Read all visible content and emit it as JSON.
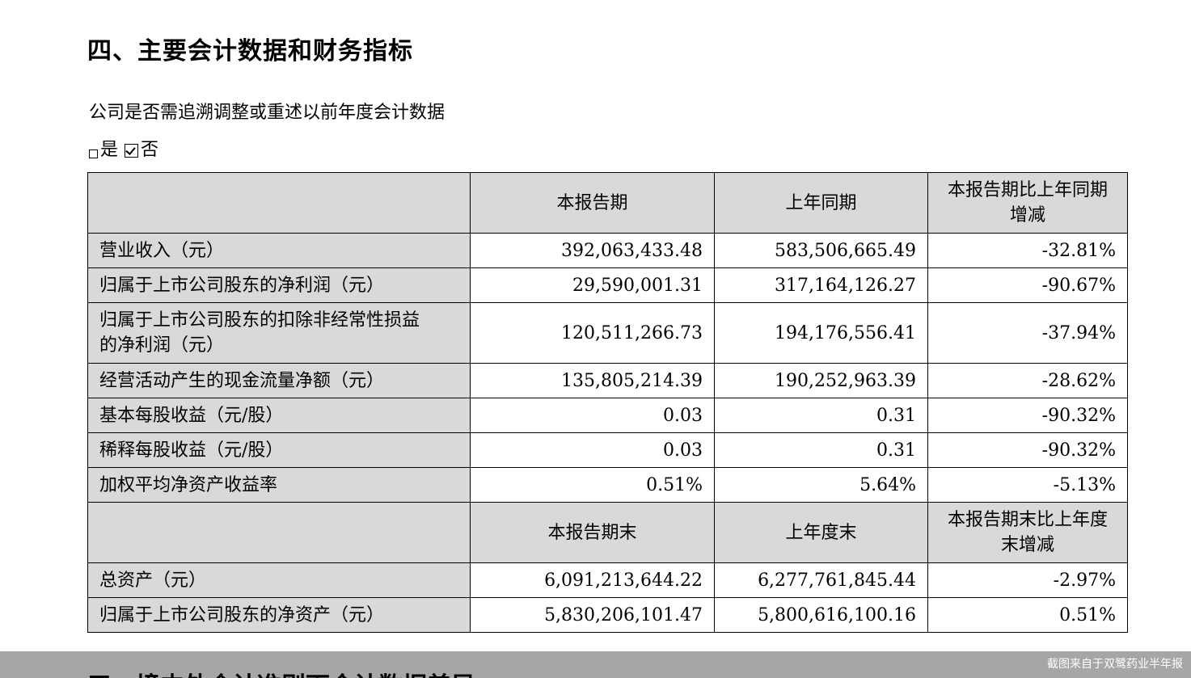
{
  "section_title": "四、主要会计数据和财务指标",
  "question": "公司是否需追溯调整或重述以前年度会计数据",
  "choices": {
    "yes_label": "是",
    "no_label": "否",
    "selected": "否"
  },
  "table": {
    "header1": {
      "label": "",
      "col1": "本报告期",
      "col2": "上年同期",
      "col3_line1": "本报告期比上年同期",
      "col3_line2": "增减"
    },
    "rows1": [
      {
        "label": "营业收入（元）",
        "current": "392,063,433.48",
        "prior": "583,506,665.49",
        "change": "-32.81%"
      },
      {
        "label": "归属于上市公司股东的净利润（元）",
        "current": "29,590,001.31",
        "prior": "317,164,126.27",
        "change": "-90.67%"
      },
      {
        "label_line1": "归属于上市公司股东的扣除非经常性损益",
        "label_line2": "的净利润（元）",
        "current": "120,511,266.73",
        "prior": "194,176,556.41",
        "change": "-37.94%"
      },
      {
        "label": "经营活动产生的现金流量净额（元）",
        "current": "135,805,214.39",
        "prior": "190,252,963.39",
        "change": "-28.62%"
      },
      {
        "label": "基本每股收益（元/股）",
        "current": "0.03",
        "prior": "0.31",
        "change": "-90.32%"
      },
      {
        "label": "稀释每股收益（元/股）",
        "current": "0.03",
        "prior": "0.31",
        "change": "-90.32%"
      },
      {
        "label": "加权平均净资产收益率",
        "current": "0.51%",
        "prior": "5.64%",
        "change": "-5.13%"
      }
    ],
    "header2": {
      "label": "",
      "col1": "本报告期末",
      "col2": "上年度末",
      "col3_line1": "本报告期末比上年度",
      "col3_line2": "末增减"
    },
    "rows2": [
      {
        "label": "总资产（元）",
        "current": "6,091,213,644.22",
        "prior": "6,277,761,845.44",
        "change": "-2.97%"
      },
      {
        "label": "归属于上市公司股东的净资产（元）",
        "current": "5,830,206,101.47",
        "prior": "5,800,616,100.16",
        "change": "0.51%"
      }
    ]
  },
  "footer": {
    "next_section_partial": "五、境内外会计准则下会计数据差异",
    "watermark": "截图来自于双鹭药业半年报"
  }
}
